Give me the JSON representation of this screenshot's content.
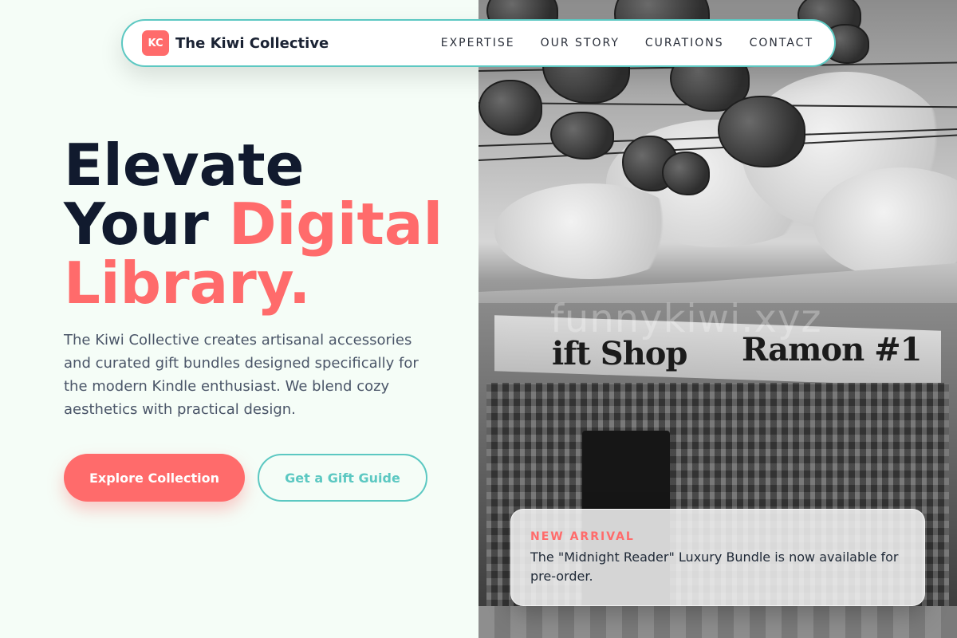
{
  "nav": {
    "logo_initials": "KC",
    "brand": "The Kiwi Collective",
    "links": [
      "EXPERTISE",
      "OUR STORY",
      "CURATIONS",
      "CONTACT"
    ]
  },
  "hero": {
    "line1": "Elevate",
    "line2_plain": "Your",
    "line2_accent": "Digital",
    "line3_accent": "Library.",
    "body": "The Kiwi Collective creates artisanal accessories and curated gift bundles designed specifically for the modern Kindle enthusiast. We blend cozy aesthetics with practical design.",
    "primary_cta": "Explore Collection",
    "secondary_cta": "Get a Gift Guide"
  },
  "photo": {
    "sign_left": "ift Shop",
    "sign_right": "Ramon #1",
    "watermark": "funnykiwi.xyz"
  },
  "announcement": {
    "tag": "NEW ARRIVAL",
    "text": "The \"Midnight Reader\" Luxury Bundle is now available for pre-order."
  },
  "colors": {
    "accent": "#ff6b6b",
    "teal": "#5cc8c2",
    "heading": "#111a2e",
    "background": "#f5fdf7"
  }
}
